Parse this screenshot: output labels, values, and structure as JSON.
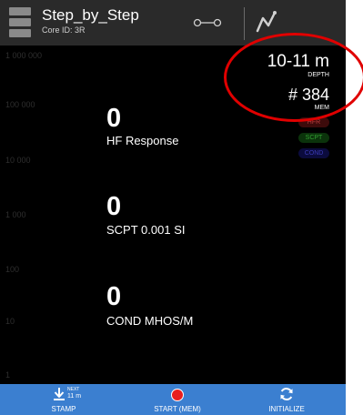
{
  "header": {
    "title": "Step_by_Step",
    "core_id": "Core ID: 3R"
  },
  "axis": {
    "labels": [
      "1 000 000",
      "100 000",
      "10 000",
      "1 000",
      "100",
      "10",
      "1"
    ]
  },
  "status": {
    "depth_value": "10-11 m",
    "depth_label": "DEPTH",
    "mem_value": "# 384",
    "mem_label": "MEM"
  },
  "legend": [
    {
      "label": "HFR",
      "color": "#ba3d3d"
    },
    {
      "label": "SCPT",
      "color": "#32a032"
    },
    {
      "label": "COND",
      "color": "#3d3dba"
    }
  ],
  "readings": [
    {
      "value": "0",
      "label": "HF Response"
    },
    {
      "value": "0",
      "label": "SCPT 0.001 SI"
    },
    {
      "value": "0",
      "label": "COND MHOS/M"
    }
  ],
  "bottom_bar": {
    "stamp_label": "STAMP",
    "stamp_next": "NEXT",
    "stamp_depth": "11 m",
    "start_label": "START (MEM)",
    "initialize_label": "INITIALIZE"
  },
  "colors": {
    "header_bg": "#2a2a2a",
    "screen_bg": "#000000",
    "bottom_bar_bg": "#3b7fd0",
    "record_red": "#e81e1e",
    "annotation_red": "#e00000"
  },
  "icons": [
    "menu-icon",
    "toggle-icon",
    "graph-icon",
    "download-arrow-icon",
    "record-icon",
    "refresh-icon"
  ]
}
